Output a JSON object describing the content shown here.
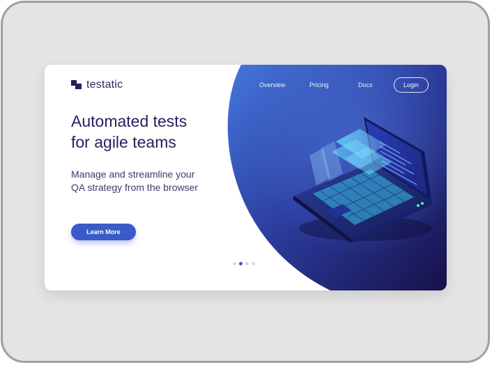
{
  "brand": {
    "name": "testatic"
  },
  "nav": {
    "items": [
      "Overview",
      "Pricing",
      "Docs"
    ],
    "login_label": "Login"
  },
  "hero": {
    "headline_line1": "Automated tests",
    "headline_line2": "for agile teams",
    "subtext_line1": "Manage and streamline your",
    "subtext_line2": "QA strategy from the browser",
    "cta_label": "Learn More"
  },
  "carousel": {
    "slides": 4,
    "active_index": 1
  },
  "colors": {
    "accent": "#3a5bc7",
    "navy": "#25235e",
    "panel_gradient_start": "#3f6fd8",
    "panel_gradient_end": "#1a1550",
    "frame": "#e4e4e4"
  }
}
